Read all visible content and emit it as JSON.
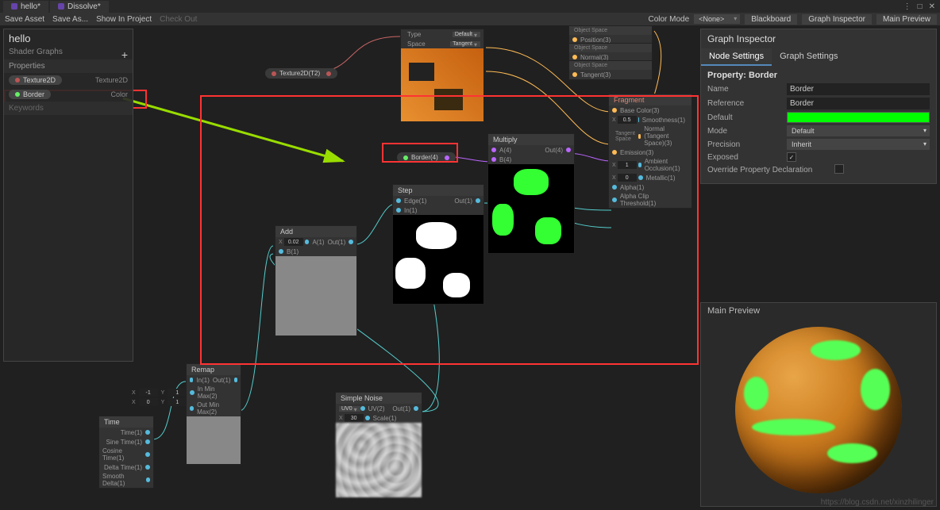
{
  "tabs": {
    "t1": "hello*",
    "t2": "Dissolve*"
  },
  "winbtns": {
    "menu": "⋮",
    "min": "—",
    "max": "□",
    "close": "✕"
  },
  "toolbar": {
    "save_asset": "Save Asset",
    "save_as": "Save As...",
    "show_in_project": "Show In Project",
    "check_out": "Check Out",
    "color_mode": "Color Mode",
    "color_mode_val": "<None>",
    "blackboard": "Blackboard",
    "graph_inspector": "Graph Inspector",
    "main_preview": "Main Preview"
  },
  "blackboard": {
    "title": "hello",
    "subtitle": "Shader Graphs",
    "section_props": "Properties",
    "add": "+",
    "items": [
      {
        "label": "Texture2D",
        "type": "Texture2D",
        "dot": "p-tex"
      },
      {
        "label": "Border",
        "type": "Color",
        "dot": "gdot"
      }
    ],
    "section_keywords": "Keywords"
  },
  "inspector": {
    "title": "Graph Inspector",
    "tab_node": "Node Settings",
    "tab_graph": "Graph Settings",
    "header": "Property: Border",
    "name_l": "Name",
    "name_v": "Border",
    "ref_l": "Reference",
    "ref_v": "Border",
    "default_l": "Default",
    "mode_l": "Mode",
    "mode_v": "Default",
    "precision_l": "Precision",
    "precision_v": "Inherit",
    "exposed_l": "Exposed",
    "exposed_v": "✓",
    "override_l": "Override Property Declaration"
  },
  "preview": {
    "title": "Main Preview"
  },
  "nodes": {
    "tex_pill": "Texture2D(T2)",
    "border_pill": "Border(4)",
    "sample_tex": {
      "type_l": "Type",
      "type_v": "Default",
      "space_l": "Space",
      "space_v": "Tangent"
    },
    "obj1": {
      "h": "Object Space",
      "out": "Position(3)"
    },
    "obj2": {
      "h": "Object Space",
      "out": "Normal(3)"
    },
    "obj3": {
      "h": "Object Space",
      "out": "Tangent(3)"
    },
    "fragment": {
      "h": "Fragment",
      "p_base": "Base Color(3)",
      "p_smooth": "Smoothness(1)",
      "smooth_x": "X",
      "smooth_v": "0.5",
      "p_normal": "Normal (Tangent Space)(3)",
      "normal_space": "Tangent Space",
      "p_emission": "Emission(3)",
      "p_ao": "Ambient Occlusion(1)",
      "ao_x": "X",
      "ao_v": "1",
      "p_metallic": "Metallic(1)",
      "metallic_x": "X",
      "metallic_v": "0",
      "p_alpha": "Alpha(1)",
      "p_clip": "Alpha Clip Threshold(1)"
    },
    "multiply": {
      "h": "Multiply",
      "a": "A(4)",
      "b": "B(4)",
      "out": "Out(4)"
    },
    "step": {
      "h": "Step",
      "edge": "Edge(1)",
      "in": "In(1)",
      "out": "Out(1)"
    },
    "add": {
      "h": "Add",
      "a": "A(1)",
      "b": "B(1)",
      "out": "Out(1)",
      "ax": "X",
      "av": "0.02"
    },
    "remap": {
      "h": "Remap",
      "in": "In(1)",
      "minmax_in": "In Min Max(2)",
      "minmax_out": "Out Min Max(2)",
      "out": "Out(1)",
      "x1l": "X",
      "x1": "-1",
      "y1l": "Y",
      "y1": "1",
      "x2l": "X",
      "x2": "0",
      "y2l": "Y",
      "y2": "1"
    },
    "time": {
      "h": "Time",
      "time": "Time(1)",
      "sine": "Sine Time(1)",
      "cos": "Cosine Time(1)",
      "delta": "Delta Time(1)",
      "smooth": "Smooth Delta(1)"
    },
    "noise": {
      "h": "Simple Noise",
      "uv": "UV(2)",
      "scale": "Scale(1)",
      "out": "Out(1)",
      "uv_l": "UV0",
      "scale_xl": "X",
      "scale_v": "30"
    }
  },
  "watermark": "https://blog.csdn.net/xinzhilinger"
}
